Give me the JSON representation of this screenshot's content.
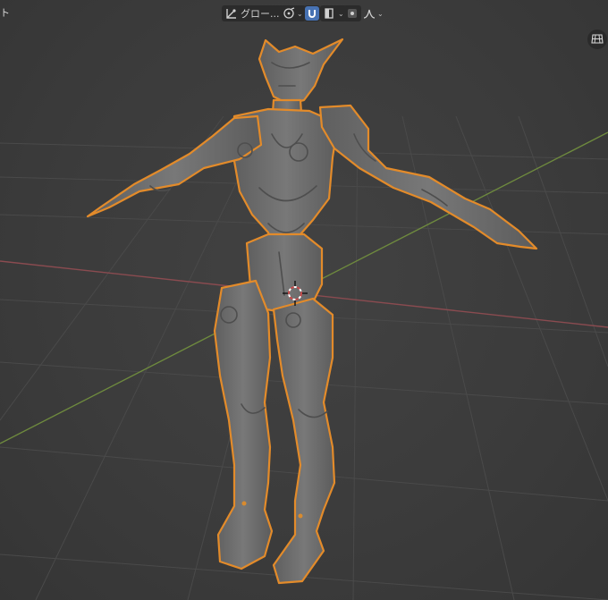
{
  "header": {
    "left_cutoff_text": "ト",
    "transform_orientation": {
      "icon": "transform-orientation-icon",
      "label": "グロー..."
    },
    "pivot": {
      "icon": "pivot-point-icon"
    },
    "snap": {
      "icon": "snap-magnet-icon",
      "active": true
    },
    "snap_target": {
      "icon": "snap-target-icon"
    },
    "proportional_edit": {
      "icon": "proportional-edit-icon"
    },
    "falloff": {
      "icon": "falloff-curve-icon"
    }
  },
  "viewport": {
    "gizmo_icon": "grid-view-icon",
    "colors": {
      "background": "#3d3d3d",
      "grid": "#4a4a4a",
      "x_axis": "#8a4b50",
      "y_axis": "#6e8a3e",
      "selection_outline": "#e38b2a",
      "mesh": "#6d6d6d"
    },
    "object": {
      "name_icon": "armored-humanoid-mesh",
      "selected": true
    },
    "cursor_icon": "3d-cursor-icon"
  }
}
